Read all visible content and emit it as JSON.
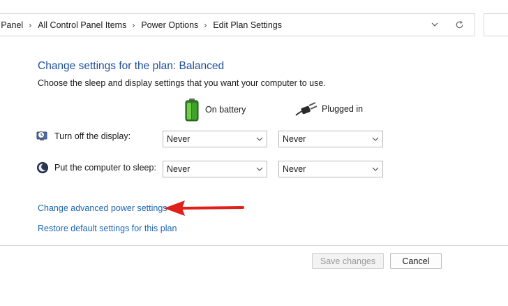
{
  "address_bar": {
    "breadcrumbs": [
      "ol Panel",
      "All Control Panel Items",
      "Power Options",
      "Edit Plan Settings"
    ],
    "dropdown_icon": "chevron-down-icon",
    "refresh_icon": "refresh-icon"
  },
  "main": {
    "title": "Change settings for the plan: Balanced",
    "subtitle": "Choose the sleep and display settings that you want your computer to use.",
    "columns": {
      "battery": "On battery",
      "plugged": "Plugged in"
    },
    "rows": {
      "display": {
        "label": "Turn off the display:",
        "battery": "Never",
        "plugged": "Never"
      },
      "sleep": {
        "label": "Put the computer to sleep:",
        "battery": "Never",
        "plugged": "Never"
      }
    },
    "links": {
      "advanced": "Change advanced power settings",
      "restore": "Restore default settings for this plan"
    },
    "annotation_color": "#e0201b"
  },
  "footer": {
    "save_label": "Save changes",
    "cancel_label": "Cancel"
  }
}
